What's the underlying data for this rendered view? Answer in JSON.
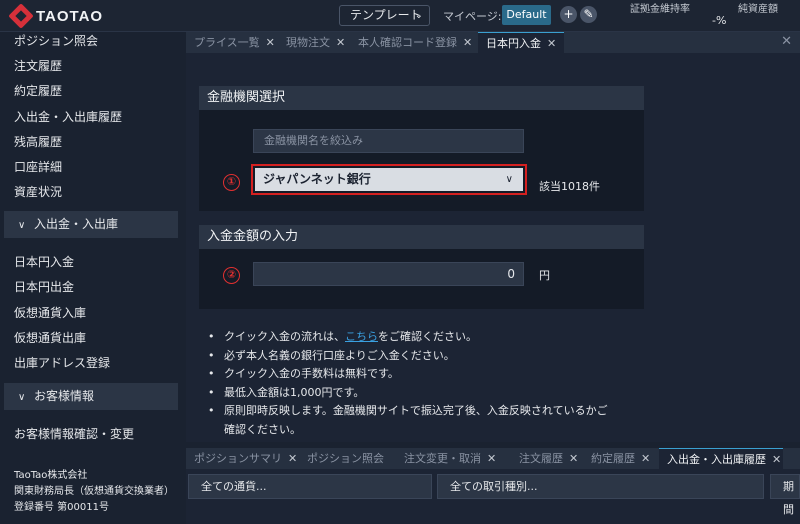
{
  "brand": {
    "name": "TAOTAO"
  },
  "topbar": {
    "template_label": "テンプレート",
    "mypage_label": "マイページ:",
    "default_badge": "Default",
    "margin_rate_label": "証拠金維持率",
    "margin_rate_value": "-%",
    "assets_label": "純資産額"
  },
  "sidebar": {
    "items_top": [
      "ポジション照会",
      "注文履歴",
      "約定履歴",
      "入出金・入出庫履歴",
      "残高履歴",
      "口座詳細",
      "資産状況"
    ],
    "section_deposit": "入出金・入出庫",
    "items_deposit": [
      "日本円入金",
      "日本円出金",
      "仮想通貨入庫",
      "仮想通貨出庫",
      "出庫アドレス登録"
    ],
    "section_customer": "お客様情報",
    "items_customer": [
      "お客様情報確認・変更"
    ],
    "company": [
      "TaoTao株式会社",
      "関東財務局長（仮想通貨交換業者）",
      "登録番号 第00011号"
    ]
  },
  "tabs": [
    "プライス一覧",
    "現物注文",
    "本人確認コード登録",
    "日本円入金"
  ],
  "bank_panel": {
    "title": "金融機関選択",
    "search_placeholder": "金融機関名を絞込み",
    "selected_bank": "ジャパンネット銀行",
    "hit_count": "該当1018件",
    "step_marker": "①"
  },
  "amount_panel": {
    "title": "入金金額の入力",
    "amount_value": "0",
    "unit": "円",
    "step_marker": "②"
  },
  "notes": {
    "n1_before": "クイック入金の流れは、",
    "n1_link": "こちら",
    "n1_after": "をご確認ください。",
    "n2": "必ず本人名義の銀行口座よりご入金ください。",
    "n3": "クイック入金の手数料は無料です。",
    "n4": "最低入金額は1,000円です。",
    "n5_line1": "原則即時反映します。金融機関サイトで振込完了後、入金反映されているかご",
    "n5_line2": "確認ください。"
  },
  "bottom_tabs": [
    "ポジションサマリ",
    "ポジション照会",
    "注文変更・取消",
    "注文履歴",
    "約定履歴",
    "入出金・入出庫履歴"
  ],
  "filters": {
    "currency": "全ての通貨...",
    "type": "全ての取引種別...",
    "period": "期間"
  },
  "colors": {
    "highlight": "#d42020",
    "accent": "#3aa0d0",
    "brand_red": "#d6303a"
  }
}
